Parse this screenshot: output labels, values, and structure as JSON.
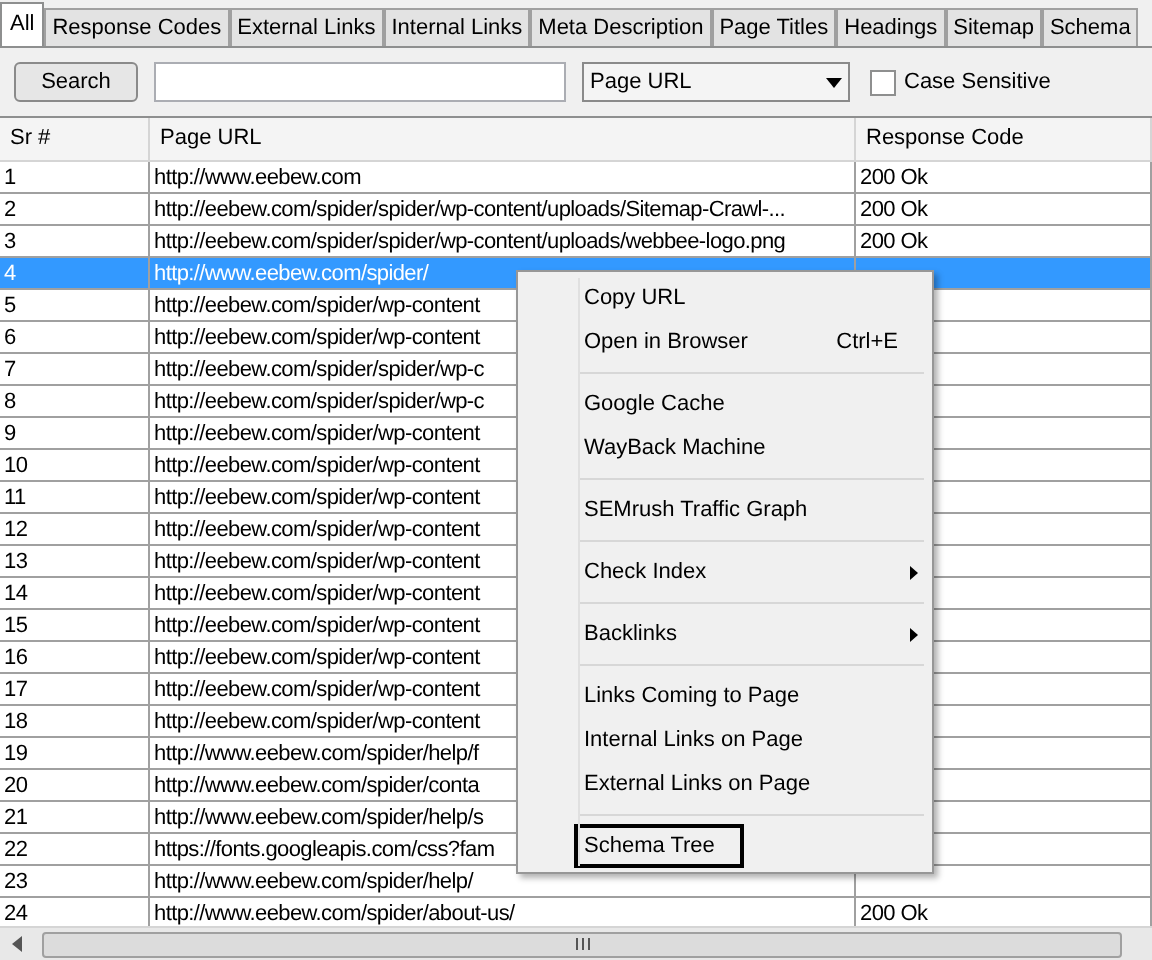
{
  "tabs": [
    {
      "label": "All",
      "selected": true
    },
    {
      "label": "Response Codes",
      "selected": false
    },
    {
      "label": "External Links",
      "selected": false
    },
    {
      "label": "Internal Links",
      "selected": false
    },
    {
      "label": "Meta Description",
      "selected": false
    },
    {
      "label": "Page Titles",
      "selected": false
    },
    {
      "label": "Headings",
      "selected": false
    },
    {
      "label": "Sitemap",
      "selected": false
    },
    {
      "label": "Schema",
      "selected": false
    }
  ],
  "toolbar": {
    "search_button": "Search",
    "filter_field": "Page URL",
    "case_sensitive": {
      "label": "Case Sensitive",
      "checked": false
    }
  },
  "table": {
    "columns": [
      "Sr #",
      "Page URL",
      "Response Code"
    ],
    "rows": [
      {
        "cells": [
          "1",
          "http://www.eebew.com",
          "200 Ok"
        ],
        "selected": false
      },
      {
        "cells": [
          "2",
          "http://eebew.com/spider/spider/wp-content/uploads/Sitemap-Crawl-...",
          "200 Ok"
        ],
        "selected": false
      },
      {
        "cells": [
          "3",
          "http://eebew.com/spider/spider/wp-content/uploads/webbee-logo.png",
          "200 Ok"
        ],
        "selected": false
      },
      {
        "cells": [
          "4",
          "http://www.eebew.com/spider/"
        ],
        "selected": true
      },
      {
        "cells": [
          "5",
          "http://eebew.com/spider/wp-content"
        ],
        "selected": false
      },
      {
        "cells": [
          "6",
          "http://eebew.com/spider/wp-content"
        ],
        "selected": false
      },
      {
        "cells": [
          "7",
          "http://eebew.com/spider/spider/wp-c"
        ],
        "selected": false
      },
      {
        "cells": [
          "8",
          "http://eebew.com/spider/spider/wp-c"
        ],
        "selected": false
      },
      {
        "cells": [
          "9",
          "http://eebew.com/spider/wp-content"
        ],
        "selected": false
      },
      {
        "cells": [
          "10",
          "http://eebew.com/spider/wp-content"
        ],
        "selected": false
      },
      {
        "cells": [
          "11",
          "http://eebew.com/spider/wp-content"
        ],
        "selected": false
      },
      {
        "cells": [
          "12",
          "http://eebew.com/spider/wp-content"
        ],
        "selected": false
      },
      {
        "cells": [
          "13",
          "http://eebew.com/spider/wp-content"
        ],
        "selected": false
      },
      {
        "cells": [
          "14",
          "http://eebew.com/spider/wp-content"
        ],
        "selected": false
      },
      {
        "cells": [
          "15",
          "http://eebew.com/spider/wp-content"
        ],
        "selected": false
      },
      {
        "cells": [
          "16",
          "http://eebew.com/spider/wp-content"
        ],
        "selected": false
      },
      {
        "cells": [
          "17",
          "http://eebew.com/spider/wp-content"
        ],
        "selected": false
      },
      {
        "cells": [
          "18",
          "http://eebew.com/spider/wp-content"
        ],
        "selected": false
      },
      {
        "cells": [
          "19",
          "http://www.eebew.com/spider/help/f"
        ],
        "selected": false
      },
      {
        "cells": [
          "20",
          "http://www.eebew.com/spider/conta"
        ],
        "selected": false
      },
      {
        "cells": [
          "21",
          "http://www.eebew.com/spider/help/s"
        ],
        "selected": false
      },
      {
        "cells": [
          "22",
          "https://fonts.googleapis.com/css?fam"
        ],
        "selected": false
      },
      {
        "cells": [
          "23",
          "http://www.eebew.com/spider/help/"
        ],
        "selected": false
      },
      {
        "cells": [
          "24",
          "http://www.eebew.com/spider/about-us/",
          "200 Ok"
        ],
        "selected": false
      }
    ]
  },
  "context_menu": {
    "groups": [
      [
        {
          "label": "Copy URL",
          "selected": false
        },
        {
          "label": "Open in Browser",
          "shortcut": "Ctrl+E",
          "selected": false
        }
      ],
      [
        {
          "label": "Google Cache",
          "selected": false
        },
        {
          "label": "WayBack Machine",
          "selected": false
        }
      ],
      [
        {
          "label": "SEMrush Traffic Graph",
          "selected": false
        }
      ],
      [
        {
          "label": "Check Index",
          "submenu": true,
          "selected": false
        }
      ],
      [
        {
          "label": "Backlinks",
          "submenu": true,
          "selected": false
        }
      ],
      [
        {
          "label": "Links Coming to Page",
          "selected": false
        },
        {
          "label": "Internal Links on Page",
          "selected": false
        },
        {
          "label": "External Links on Page",
          "selected": false
        }
      ],
      [
        {
          "label": "Schema Tree",
          "selected": true
        }
      ]
    ]
  }
}
